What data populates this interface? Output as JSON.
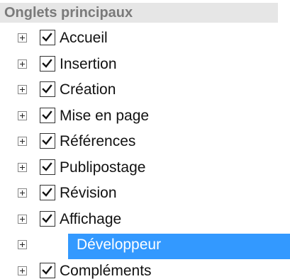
{
  "header": {
    "title": "Onglets principaux"
  },
  "colors": {
    "selection": "#3399ff",
    "header_bg": "#e6e6e6",
    "header_text": "#7a7a7a"
  },
  "items": [
    {
      "label": "Accueil",
      "checked": true,
      "selected": false
    },
    {
      "label": "Insertion",
      "checked": true,
      "selected": false
    },
    {
      "label": "Création",
      "checked": true,
      "selected": false
    },
    {
      "label": "Mise en page",
      "checked": true,
      "selected": false
    },
    {
      "label": "Références",
      "checked": true,
      "selected": false
    },
    {
      "label": "Publipostage",
      "checked": true,
      "selected": false
    },
    {
      "label": "Révision",
      "checked": true,
      "selected": false
    },
    {
      "label": "Affichage",
      "checked": true,
      "selected": false
    },
    {
      "label": "Développeur",
      "checked": false,
      "selected": true
    },
    {
      "label": "Compléments",
      "checked": true,
      "selected": false
    }
  ]
}
